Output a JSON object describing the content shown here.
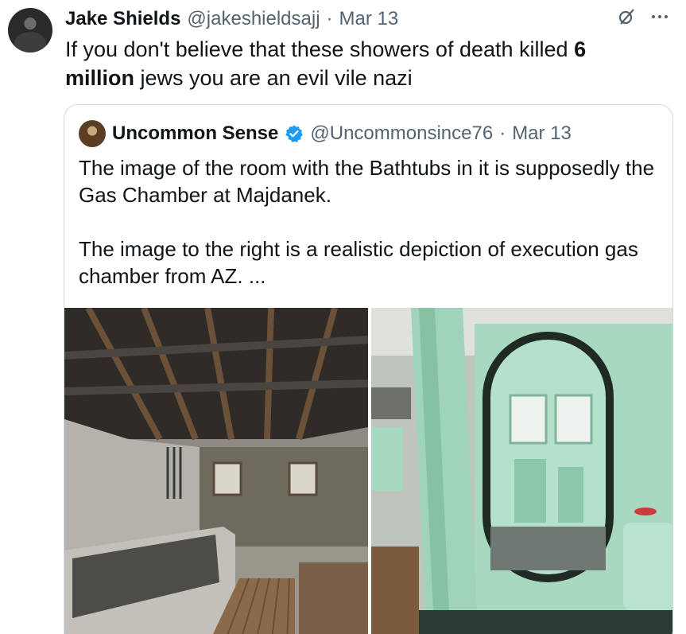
{
  "tweet": {
    "display_name": "Jake Shields",
    "handle": "@jakeshieldsajj",
    "separator": "·",
    "date": "Mar 13",
    "text_before": "If you don't believe that these showers of death killed ",
    "text_bold_1": "6",
    "text_space": " ",
    "text_bold_2": "million",
    "text_after": " jews you are an evil vile nazi"
  },
  "quote": {
    "display_name": "Uncommon Sense",
    "handle": "@Uncommonsince76",
    "separator": "·",
    "date": "Mar 13",
    "paragraph_1": "The image of the room with the Bathtubs in it is supposedly the Gas Chamber at Majdanek.",
    "paragraph_2": "The image to the right is a realistic depiction of execution gas chamber from AZ. ..."
  },
  "icons": {
    "grok": "grok-icon",
    "more": "more-icon",
    "verified": "verified-badge-icon",
    "verified_color": "#1d9bf0"
  },
  "colors": {
    "text_primary": "#0f1419",
    "text_secondary": "#536471",
    "border": "#cfd9de",
    "chamber_green": "#a8d8c0"
  }
}
